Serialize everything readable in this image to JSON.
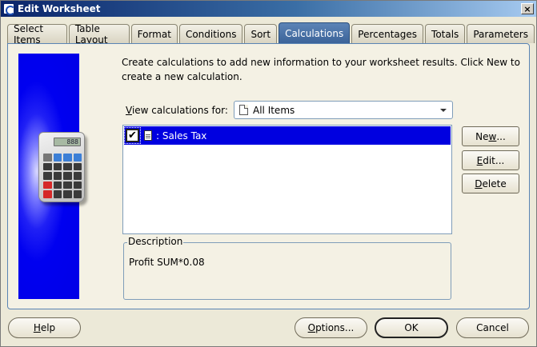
{
  "window": {
    "title": "Edit Worksheet",
    "close_glyph": "×"
  },
  "tabs": [
    {
      "label": "Select Items",
      "active": false
    },
    {
      "label": "Table Layout",
      "active": false
    },
    {
      "label": "Format",
      "active": false
    },
    {
      "label": "Conditions",
      "active": false
    },
    {
      "label": "Sort",
      "active": false
    },
    {
      "label": "Calculations",
      "active": true
    },
    {
      "label": "Percentages",
      "active": false
    },
    {
      "label": "Totals",
      "active": false
    },
    {
      "label": "Parameters",
      "active": false
    }
  ],
  "main": {
    "intro_text": "Create calculations to add new information to your worksheet results. Click New to create a new calculation.",
    "view_label_prefix": "V",
    "view_label_rest": "iew calculations for:",
    "view_select": {
      "value": "All Items",
      "icon": "document-icon"
    },
    "calculator_display": "888",
    "calculations": [
      {
        "label": ": Sales Tax",
        "checked": true,
        "selected": true,
        "icon": "calculation-doc-icon"
      }
    ],
    "description": {
      "legend": "Description",
      "text": "Profit SUM*0.08"
    }
  },
  "side_buttons": {
    "new": {
      "pre": "Ne",
      "mn": "w",
      "post": "..."
    },
    "edit": {
      "pre": "",
      "mn": "E",
      "post": "dit..."
    },
    "delete": {
      "pre": "",
      "mn": "D",
      "post": "elete"
    }
  },
  "footer": {
    "help": {
      "pre": "",
      "mn": "H",
      "post": "elp"
    },
    "options": {
      "pre": "",
      "mn": "O",
      "post": "ptions..."
    },
    "ok": "OK",
    "cancel": "Cancel"
  },
  "colors": {
    "title_start": "#0a246a",
    "tab_active": "#3b6399",
    "selection": "#0000e0",
    "side_panel": "#0000f0"
  }
}
